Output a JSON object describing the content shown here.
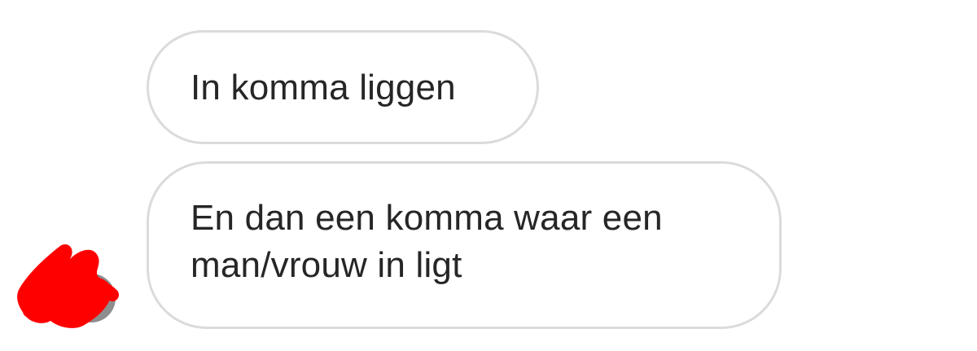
{
  "conversation": {
    "messages": [
      {
        "text": "In komma liggen"
      },
      {
        "text": "En dan een komma waar een man/vrouw in ligt"
      }
    ]
  },
  "avatar": {
    "icon": "redacted-avatar-icon",
    "redaction_color": "#ff0000"
  },
  "colors": {
    "bubble_border": "#dbdbdb",
    "bubble_text": "#262626",
    "background": "#ffffff"
  }
}
